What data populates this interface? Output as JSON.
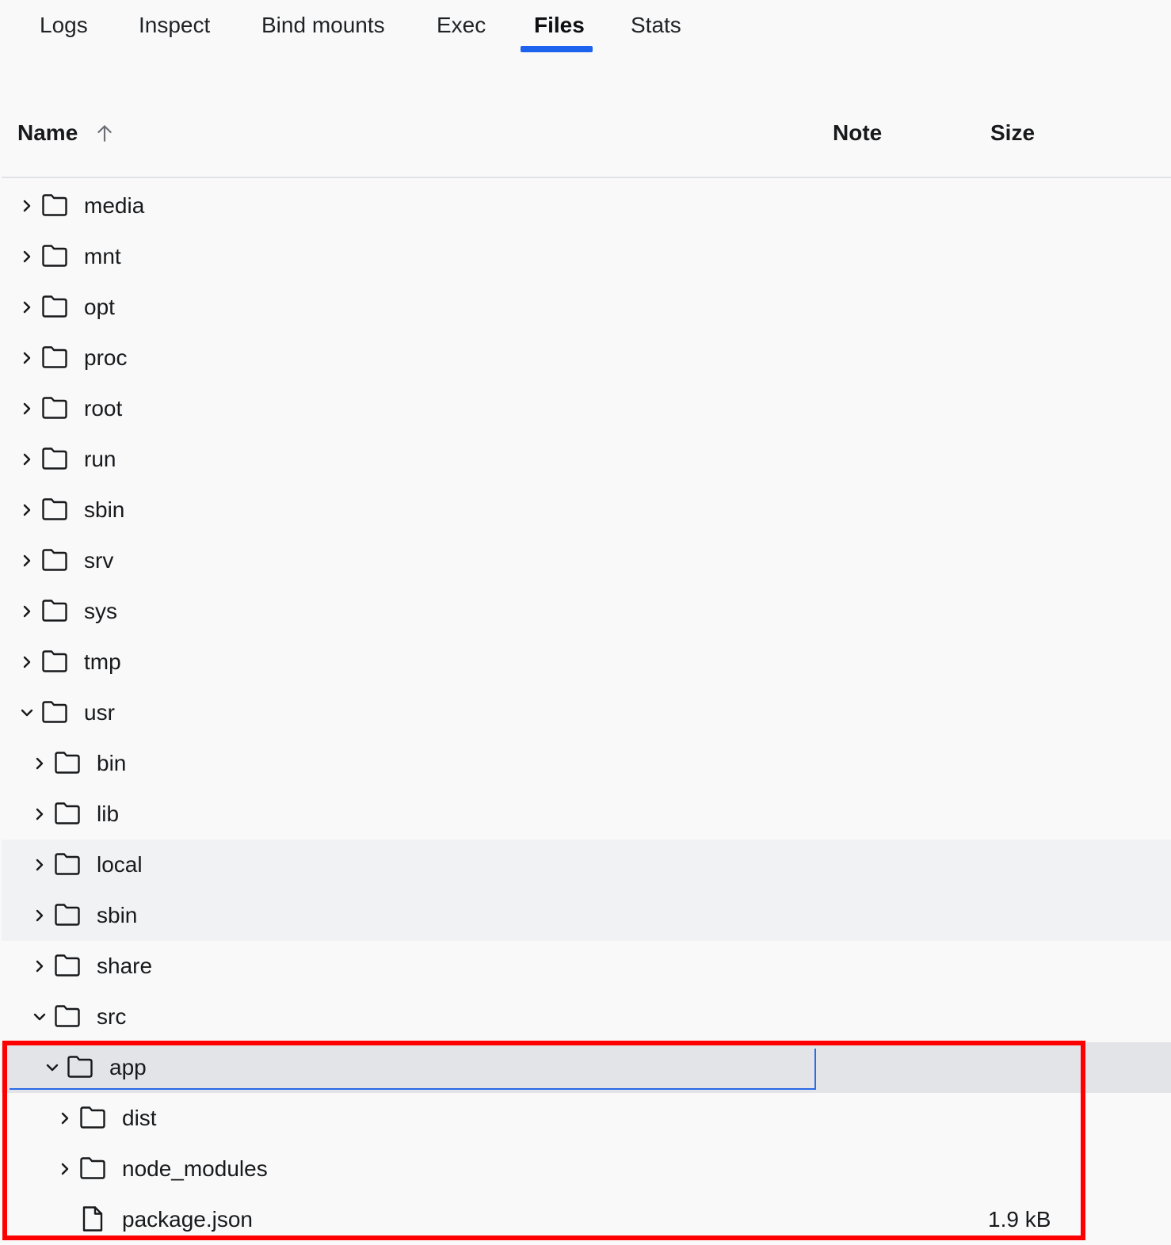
{
  "tabs": [
    {
      "label": "Logs"
    },
    {
      "label": "Inspect"
    },
    {
      "label": "Bind mounts"
    },
    {
      "label": "Exec"
    },
    {
      "label": "Files",
      "active": true
    },
    {
      "label": "Stats"
    }
  ],
  "table": {
    "columns": {
      "name": "Name",
      "note": "Note",
      "size": "Size"
    },
    "sort": {
      "column": "Name",
      "direction": "ascending",
      "icon": "arrow-up-icon"
    },
    "rows": [
      {
        "name": "media",
        "type": "folder",
        "expanded": false
      },
      {
        "name": "mnt",
        "type": "folder",
        "expanded": false
      },
      {
        "name": "opt",
        "type": "folder",
        "expanded": false
      },
      {
        "name": "proc",
        "type": "folder",
        "expanded": false
      },
      {
        "name": "root",
        "type": "folder",
        "expanded": false
      },
      {
        "name": "run",
        "type": "folder",
        "expanded": false
      },
      {
        "name": "sbin",
        "type": "folder",
        "expanded": false
      },
      {
        "name": "srv",
        "type": "folder",
        "expanded": false
      },
      {
        "name": "sys",
        "type": "folder",
        "expanded": false
      },
      {
        "name": "tmp",
        "type": "folder",
        "expanded": false
      },
      {
        "name": "usr",
        "type": "folder",
        "expanded": true
      },
      {
        "name": "bin",
        "type": "folder",
        "expanded": false
      },
      {
        "name": "lib",
        "type": "folder",
        "expanded": false
      },
      {
        "name": "local",
        "type": "folder",
        "expanded": false,
        "state": "hover"
      },
      {
        "name": "sbin",
        "type": "folder",
        "expanded": false,
        "state": "hover"
      },
      {
        "name": "share",
        "type": "folder",
        "expanded": false
      },
      {
        "name": "src",
        "type": "folder",
        "expanded": true
      },
      {
        "name": "app",
        "type": "folder",
        "expanded": true,
        "state": "selected"
      },
      {
        "name": "dist",
        "type": "folder",
        "expanded": false
      },
      {
        "name": "node_modules",
        "type": "folder",
        "expanded": false
      },
      {
        "name": "package.json",
        "type": "file",
        "size": "1.9 kB"
      }
    ]
  },
  "colors": {
    "accent": "#1d63ed",
    "highlight_box": "#ff0000",
    "selected_row": "#e3e4e8",
    "hover_row": "#f1f2f4"
  }
}
